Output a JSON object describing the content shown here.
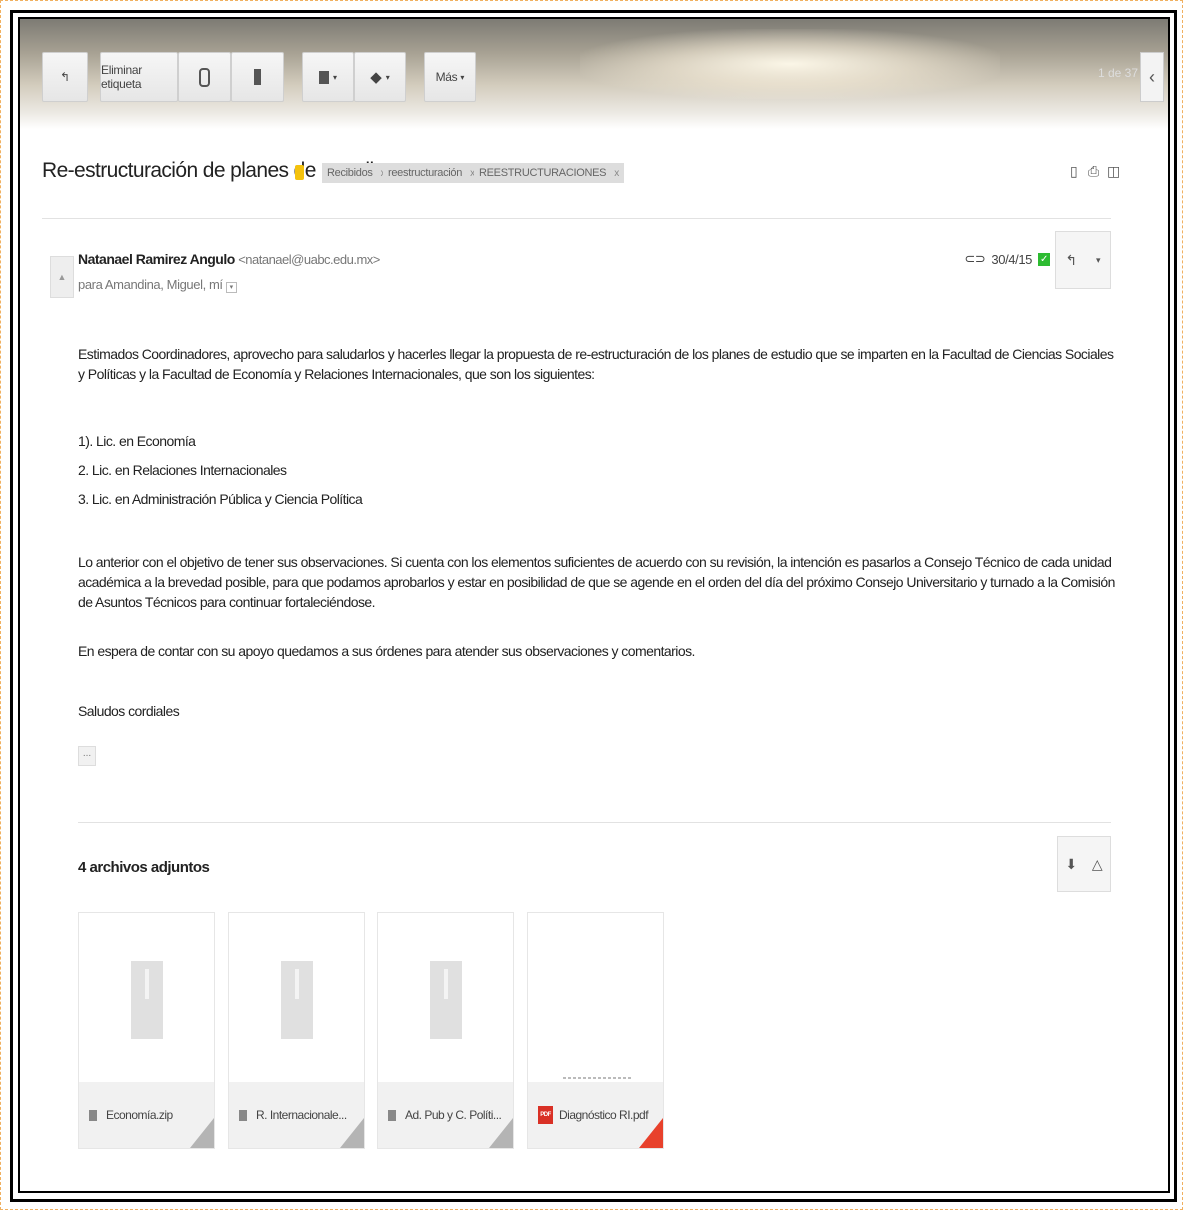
{
  "toolbar": {
    "back_icon": "arrow-back-icon",
    "remove_label": "Eliminar etiqueta",
    "report_icon": "report-spam-icon",
    "delete_icon": "trash-icon",
    "move_icon": "folder-icon",
    "labels_icon": "tag-icon",
    "more_label": "Más",
    "page_count": "1 de 37"
  },
  "email": {
    "subject": "Re-estructuración de planes de estudio",
    "labels": [
      "Recibidos",
      "reestructuración",
      "REESTRUCTURACIONES"
    ],
    "sender_name": "Natanael Ramirez Angulo",
    "sender_email": "<natanael@uabc.edu.mx>",
    "recipients": "para Amandina, Miguel, mí",
    "date": "30/4/15",
    "body": {
      "p1": "Estimados Coordinadores, aprovecho para saludarlos  y hacerles llegar la propuesta de re-estructuración de los planes de estudio que se imparten en la Facultad de Ciencias Sociales y Políticas y la Facultad de Economía y Relaciones Internacionales, que son los siguientes:",
      "list": [
        "1). Lic. en Economía",
        "2. Lic. en Relaciones Internacionales",
        "3. Lic. en Administración Pública y Ciencia Política"
      ],
      "p2": "Lo anterior con el objetivo de tener sus observaciones. Si cuenta con los elementos suficientes de acuerdo con su revisión, la intención es pasarlos a Consejo Técnico de cada unidad académica a la brevedad posible, para que podamos aprobarlos  y estar en posibilidad de que se agende en el orden del día del próximo Consejo Universitario y turnado a la Comisión de Asuntos Técnicos para continuar fortaleciéndose.",
      "p3": "En espera de contar con su apoyo quedamos a sus órdenes para atender sus observaciones y comentarios.",
      "p4": "Saludos cordiales",
      "ellipsis": "..."
    }
  },
  "attachments": {
    "title": "4 archivos adjuntos",
    "files": [
      {
        "name": "Economía.zip",
        "type": "zip"
      },
      {
        "name": "R. Internacionale...",
        "type": "zip"
      },
      {
        "name": "Ad. Pub y C. Políti...",
        "type": "zip"
      },
      {
        "name": "Diagnóstico RI.pdf",
        "type": "pdf"
      }
    ],
    "pdf_badge": "PDF"
  },
  "colors": {
    "important": "#f4c20d",
    "check": "#2dbb31",
    "pdf": "#d93025"
  }
}
